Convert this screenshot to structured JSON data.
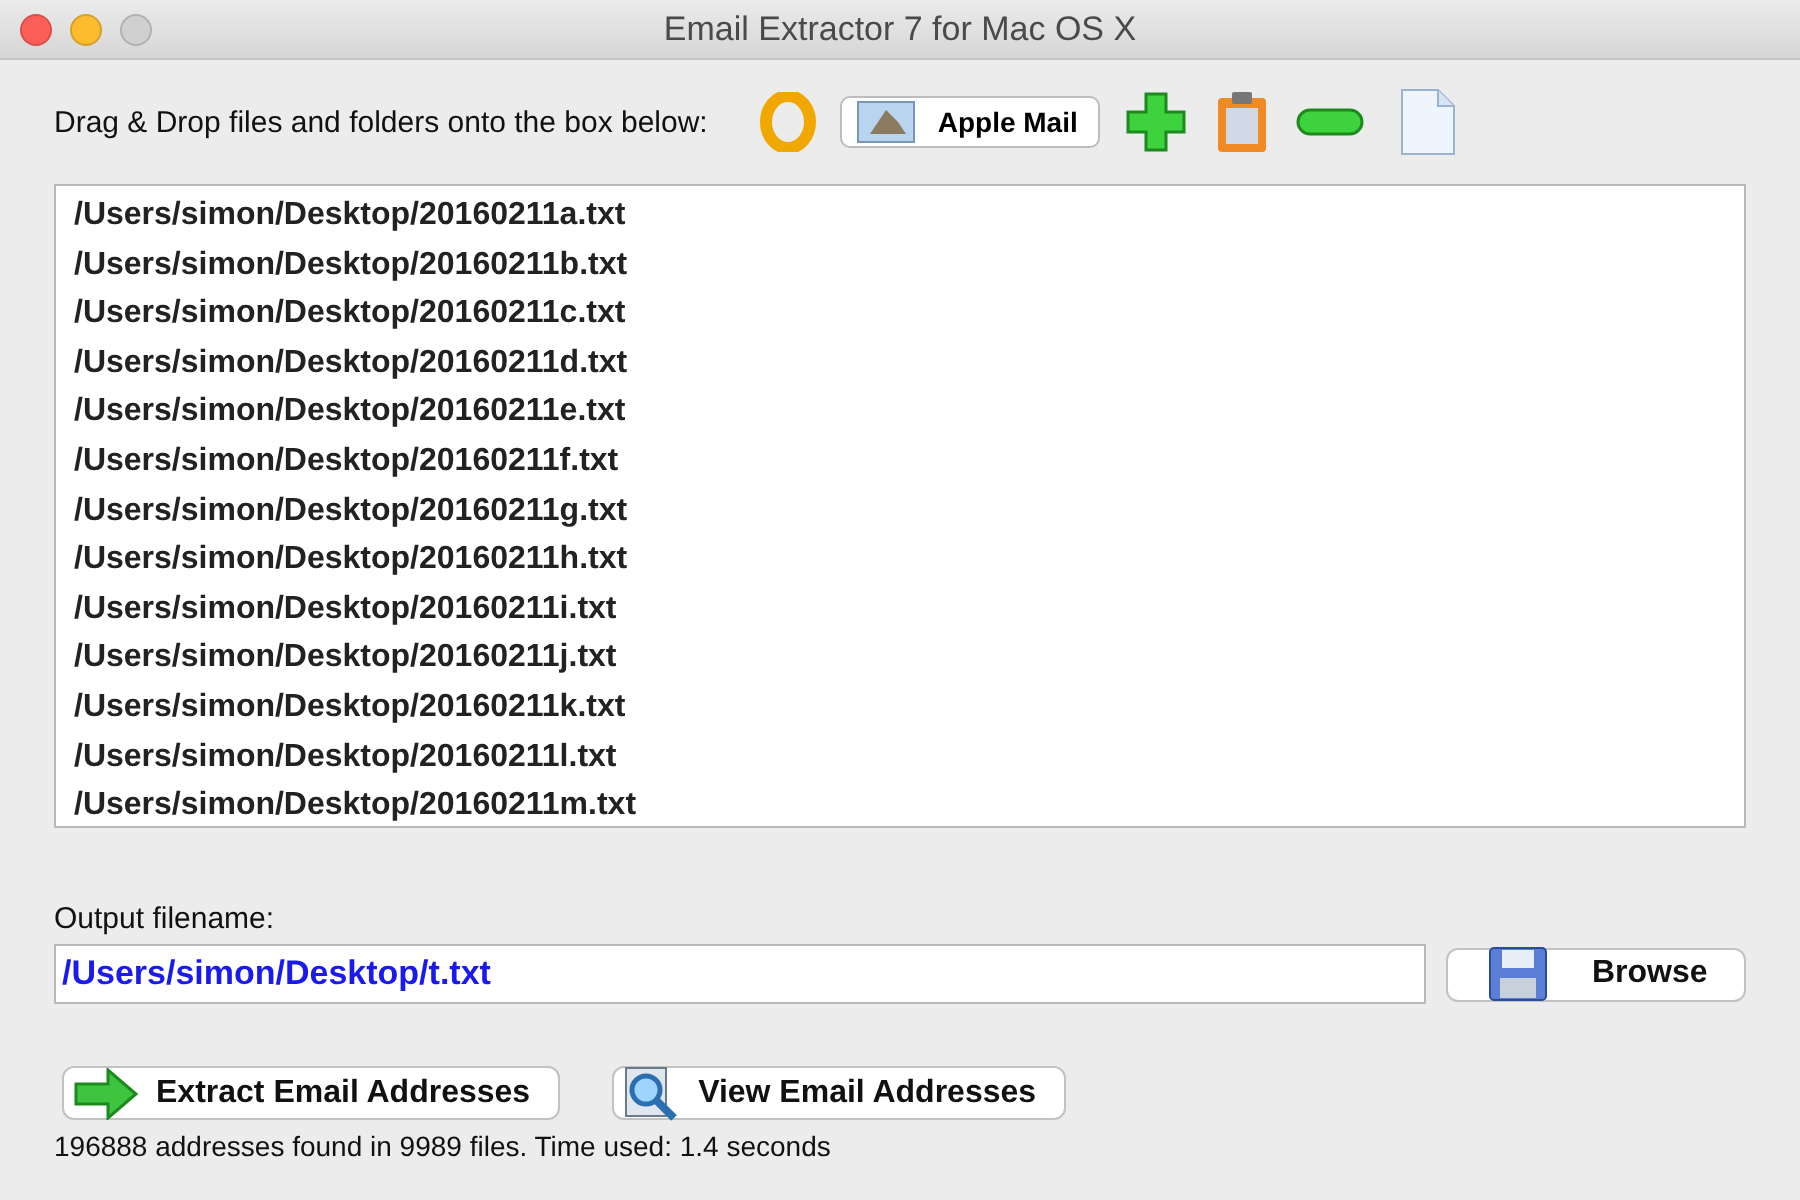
{
  "window": {
    "title": "Email Extractor 7 for Mac OS X"
  },
  "toolbar": {
    "label": "Drag & Drop files and folders onto the box below:",
    "apple_mail_button": "Apple Mail"
  },
  "files": [
    "/Users/simon/Desktop/20160211a.txt",
    "/Users/simon/Desktop/20160211b.txt",
    "/Users/simon/Desktop/20160211c.txt",
    "/Users/simon/Desktop/20160211d.txt",
    "/Users/simon/Desktop/20160211e.txt",
    "/Users/simon/Desktop/20160211f.txt",
    "/Users/simon/Desktop/20160211g.txt",
    "/Users/simon/Desktop/20160211h.txt",
    "/Users/simon/Desktop/20160211i.txt",
    "/Users/simon/Desktop/20160211j.txt",
    "/Users/simon/Desktop/20160211k.txt",
    "/Users/simon/Desktop/20160211l.txt",
    "/Users/simon/Desktop/20160211m.txt"
  ],
  "output": {
    "label": "Output filename:",
    "value": "/Users/simon/Desktop/t.txt",
    "browse_button": "Browse"
  },
  "actions": [
    {
      "kind": "extract",
      "label": "Extract Email Addresses"
    },
    {
      "kind": "view",
      "label": "View Email Addresses"
    }
  ],
  "status_bar": "196888 addresses found in 9989 files. Time used: 1.4 seconds"
}
